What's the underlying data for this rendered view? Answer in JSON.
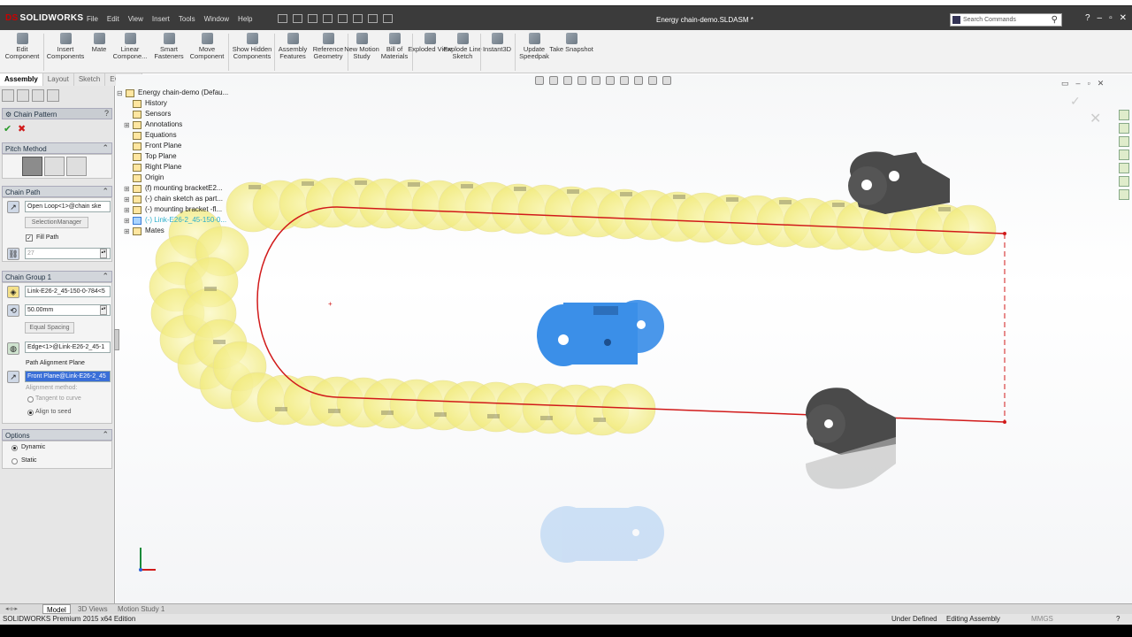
{
  "app": {
    "logo": "SOLIDWORKS",
    "logo_mark": "DS",
    "title": "Energy chain-demo.SLDASM *"
  },
  "menus": [
    "File",
    "Edit",
    "View",
    "Insert",
    "Tools",
    "Window",
    "Help"
  ],
  "search": {
    "placeholder": "Search Commands"
  },
  "commands": [
    {
      "label": "Edit Component"
    },
    {
      "label": "Insert Components"
    },
    {
      "label": "Mate"
    },
    {
      "label": "Linear Compone..."
    },
    {
      "label": "Smart Fasteners"
    },
    {
      "label": "Move Component"
    },
    {
      "label": "Show Hidden Components"
    },
    {
      "label": "Assembly Features"
    },
    {
      "label": "Reference Geometry"
    },
    {
      "label": "New Motion Study"
    },
    {
      "label": "Bill of Materials"
    },
    {
      "label": "Exploded View"
    },
    {
      "label": "Explode Line Sketch"
    },
    {
      "label": "Instant3D"
    },
    {
      "label": "Update Speedpak"
    },
    {
      "label": "Take Snapshot"
    }
  ],
  "tabs": [
    "Assembly",
    "Layout",
    "Sketch",
    "Evaluate"
  ],
  "panel": {
    "title": "Chain Pattern",
    "pitch_method": "Pitch Method",
    "chain_path": "Chain Path",
    "path_value": "Open Loop<1>@chain ske",
    "selection_manager": "SelectionManager",
    "fill_path": "Fill Path",
    "count": "27",
    "chain_group": "Chain Group 1",
    "link_value": "Link-E26-2_45-150-0-784<5",
    "distance": "50.00mm",
    "equal_spacing": "Equal Spacing",
    "edge_value": "Edge<1>@Link-E26-2_45-1",
    "path_alignment_plane": "Path Alignment Plane",
    "plane_value": "Front Plane@Link-E26-2_45",
    "alignment_method": "Alignment method:",
    "tangent": "Tangent to curve",
    "align_seed": "Align to seed",
    "options": "Options",
    "dynamic": "Dynamic",
    "static": "Static"
  },
  "tree": [
    {
      "label": "Energy chain-demo  (Defau..."
    },
    {
      "label": "History"
    },
    {
      "label": "Sensors"
    },
    {
      "label": "Annotations"
    },
    {
      "label": "Equations"
    },
    {
      "label": "Front Plane"
    },
    {
      "label": "Top Plane"
    },
    {
      "label": "Right Plane"
    },
    {
      "label": "Origin"
    },
    {
      "label": "(f) mounting bracketE2..."
    },
    {
      "label": "(-) chain sketch as part..."
    },
    {
      "label": "(-) mounting bracket -fl..."
    },
    {
      "label": "(-) Link-E26-2_45-150-0..."
    },
    {
      "label": "Mates"
    }
  ],
  "bottom_tabs": [
    "Model",
    "3D Views",
    "Motion Study 1"
  ],
  "status": {
    "edition": "SOLIDWORKS Premium 2015 x64 Edition",
    "state": "Under Defined",
    "mode": "Editing Assembly",
    "units": "MMGS"
  },
  "colors": {
    "link_yellow": "#f5f08a",
    "highlight_blue": "#3b8fe8",
    "bracket": "#4a4a4a",
    "path_red": "#d11a1a"
  }
}
